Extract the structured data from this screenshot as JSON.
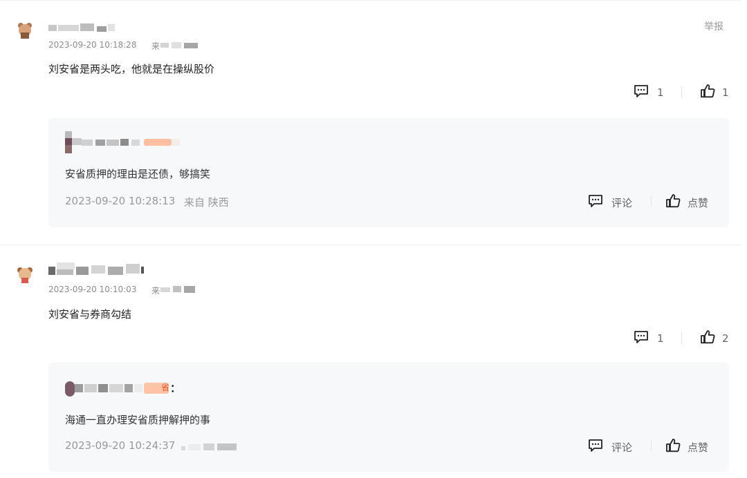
{
  "comments": [
    {
      "report_label": "举报",
      "timestamp": "2023-09-20 10:18:28",
      "location_prefix": "来",
      "text": "刘安省是两头吃，他就是在操纵股价",
      "reply_count": "1",
      "like_count": "1",
      "reply": {
        "text": "安省质押的理由是还债，够搞笑",
        "timestamp": "2023-09-20 10:28:13",
        "location": "来自 陕西",
        "comment_label": "评论",
        "like_label": "点赞"
      }
    },
    {
      "timestamp": "2023-09-20 10:10:03",
      "location_prefix": "来",
      "text": "刘安省与券商勾结",
      "reply_count": "1",
      "like_count": "2",
      "reply": {
        "author_suffix": "：",
        "badge_text": "省",
        "text": "海通一直办理安省质押解押的事",
        "timestamp": "2023-09-20 10:24:37",
        "comment_label": "评论",
        "like_label": "点赞"
      }
    }
  ],
  "icons": {
    "comment": "comment-bubble-icon",
    "like": "thumbs-up-icon"
  },
  "colors": {
    "reply_background": "#f7f8fa",
    "badge": "#ffb9a0",
    "meta_text": "#999999",
    "divider": "#f0f0f0"
  }
}
